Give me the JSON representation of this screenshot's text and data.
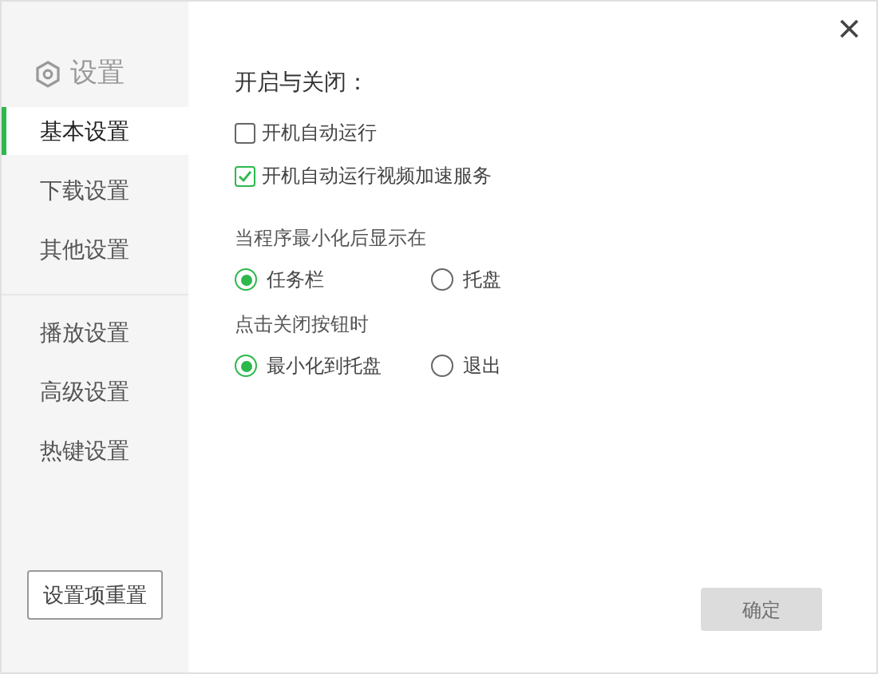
{
  "sidebar": {
    "title": "设置",
    "groups": [
      [
        {
          "label": "基本设置",
          "selected": true
        },
        {
          "label": "下载设置",
          "selected": false
        },
        {
          "label": "其他设置",
          "selected": false
        }
      ],
      [
        {
          "label": "播放设置",
          "selected": false
        },
        {
          "label": "高级设置",
          "selected": false
        },
        {
          "label": "热键设置",
          "selected": false
        }
      ]
    ],
    "reset_button": "设置项重置"
  },
  "content": {
    "heading": "开启与关闭：",
    "checkboxes": [
      {
        "label": "开机自动运行",
        "checked": false
      },
      {
        "label": "开机自动运行视频加速服务",
        "checked": true
      }
    ],
    "radio_groups": [
      {
        "label": "当程序最小化后显示在",
        "options": [
          {
            "label": "任务栏",
            "selected": true
          },
          {
            "label": "托盘",
            "selected": false
          }
        ]
      },
      {
        "label": "点击关闭按钮时",
        "options": [
          {
            "label": "最小化到托盘",
            "selected": true
          },
          {
            "label": "退出",
            "selected": false
          }
        ]
      }
    ]
  },
  "ok_button": {
    "label": "确定",
    "disabled": true
  }
}
